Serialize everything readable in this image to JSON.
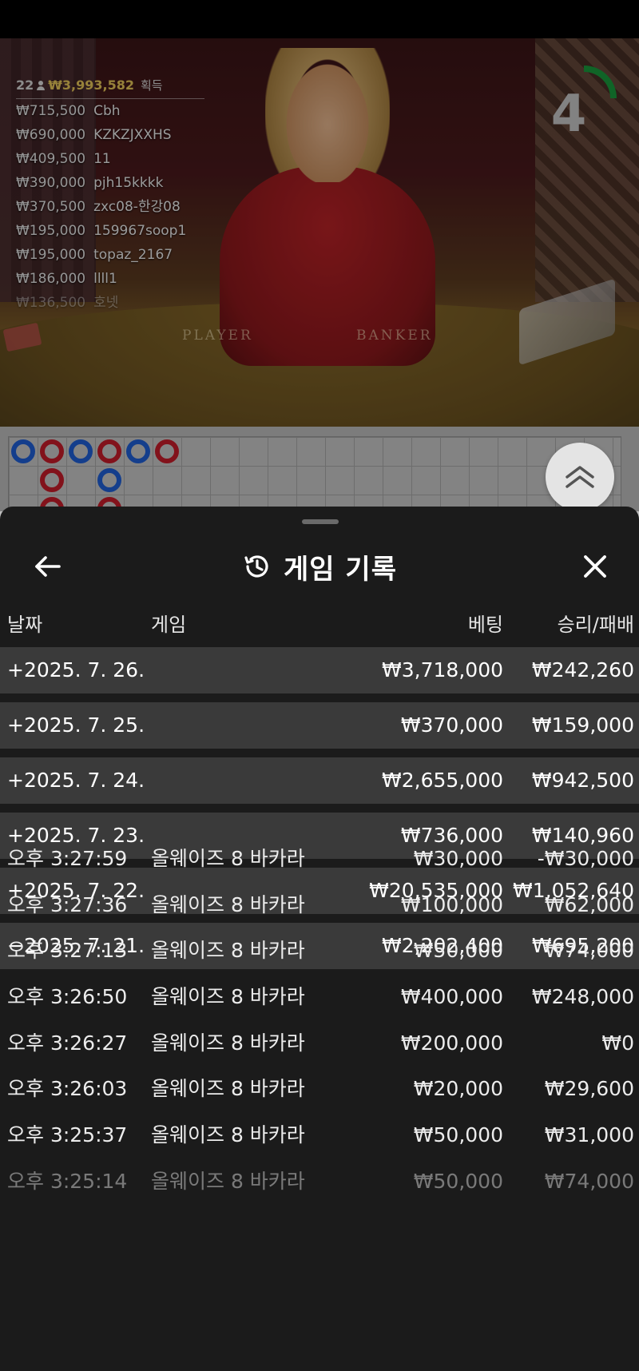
{
  "stream": {
    "table_labels": [
      "PLAYER",
      "BANKER"
    ],
    "timer": "4",
    "timer_progress": 0.25,
    "winners": {
      "count": "22",
      "total": "₩3,993,582",
      "label": "획득",
      "list": [
        {
          "amount": "₩715,500",
          "name": "Cbh"
        },
        {
          "amount": "₩690,000",
          "name": "KZKZJXXHS"
        },
        {
          "amount": "₩409,500",
          "name": "11"
        },
        {
          "amount": "₩390,000",
          "name": "pjh15kkkk"
        },
        {
          "amount": "₩370,500",
          "name": "zxc08-한강08"
        },
        {
          "amount": "₩195,000",
          "name": "159967soop1"
        },
        {
          "amount": "₩195,000",
          "name": "topaz_2167"
        },
        {
          "amount": "₩186,000",
          "name": "llll1"
        },
        {
          "amount": "₩136,500",
          "name": "호넷"
        }
      ]
    }
  },
  "roadmap": {
    "beads": [
      {
        "col": 0,
        "row": 0,
        "color": "blue"
      },
      {
        "col": 1,
        "row": 0,
        "color": "red"
      },
      {
        "col": 1,
        "row": 1,
        "color": "red"
      },
      {
        "col": 1,
        "row": 2,
        "color": "red"
      },
      {
        "col": 2,
        "row": 0,
        "color": "blue"
      },
      {
        "col": 3,
        "row": 0,
        "color": "red"
      },
      {
        "col": 3,
        "row": 1,
        "color": "blue"
      },
      {
        "col": 3,
        "row": 2,
        "color": "red"
      },
      {
        "col": 4,
        "row": 0,
        "color": "blue"
      },
      {
        "col": 5,
        "row": 0,
        "color": "red"
      }
    ]
  },
  "panel": {
    "title": "게임 기록",
    "columns": {
      "date": "날짜",
      "game": "게임",
      "bet": "베팅",
      "win_loss": "승리/패배"
    },
    "days": [
      {
        "date": "+2025. 7. 26.",
        "bet": "₩3,718,000",
        "win_loss": "₩242,260"
      },
      {
        "date": "+2025. 7. 25.",
        "bet": "₩370,000",
        "win_loss": "₩159,000"
      },
      {
        "date": "+2025. 7. 24.",
        "bet": "₩2,655,000",
        "win_loss": "₩942,500"
      },
      {
        "date": "+2025. 7. 23.",
        "bet": "₩736,000",
        "win_loss": "₩140,960"
      },
      {
        "date": "+2025. 7. 22.",
        "bet": "₩20,535,000",
        "win_loss": "₩1,052,640"
      },
      {
        "date": "−2025. 7. 21.",
        "bet": "₩2,202,400",
        "win_loss": "₩695,200"
      }
    ],
    "sessions": [
      {
        "time": "오후 3:27:59",
        "game": "올웨이즈 8 바카라",
        "bet": "₩30,000",
        "win_loss": "-₩30,000"
      },
      {
        "time": "오후 3:27:36",
        "game": "올웨이즈 8 바카라",
        "bet": "₩100,000",
        "win_loss": "₩62,000"
      },
      {
        "time": "오후 3:27:13",
        "game": "올웨이즈 8 바카라",
        "bet": "₩50,000",
        "win_loss": "₩74,000"
      },
      {
        "time": "오후 3:26:50",
        "game": "올웨이즈 8 바카라",
        "bet": "₩400,000",
        "win_loss": "₩248,000"
      },
      {
        "time": "오후 3:26:27",
        "game": "올웨이즈 8 바카라",
        "bet": "₩200,000",
        "win_loss": "₩0"
      },
      {
        "time": "오후 3:26:03",
        "game": "올웨이즈 8 바카라",
        "bet": "₩20,000",
        "win_loss": "₩29,600"
      },
      {
        "time": "오후 3:25:37",
        "game": "올웨이즈 8 바카라",
        "bet": "₩50,000",
        "win_loss": "₩31,000"
      },
      {
        "time": "오후 3:25:14",
        "game": "올웨이즈 8 바카라",
        "bet": "₩50,000",
        "win_loss": "₩74,000"
      }
    ]
  }
}
